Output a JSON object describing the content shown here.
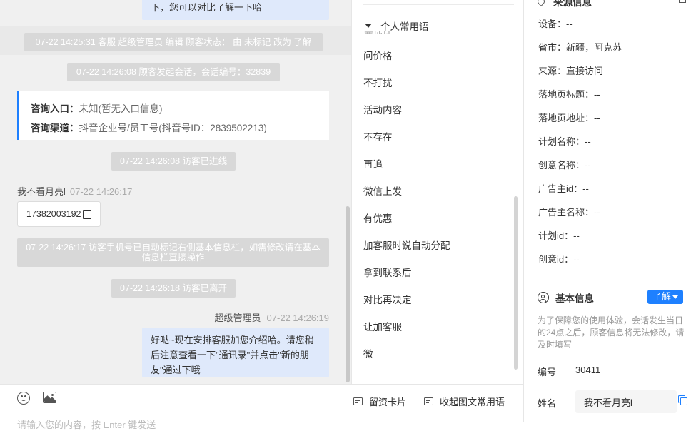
{
  "chat": {
    "top_bubble_text": "下，您可以对比了解一下哈",
    "system_status_change": "07-22 14:25:31 客服 超级管理员 编辑 顾客状态： 由 未标记 改为 了解",
    "system_session_start": "07-22 14:26:08 顾客发起会话，会话编号：32839",
    "consult_entry_label": "咨询入口：",
    "consult_entry_value": "未知(暂无入口信息)",
    "consult_channel_label": "咨询渠道：",
    "consult_channel_value": "抖音企业号/员工号(抖音号ID：2839502213)",
    "system_entered": "07-22 14:26:08 访客已进线",
    "visitor_name": "我不看月亮l",
    "visitor_time": "07-22 14:26:17",
    "visitor_phone": "17382003192",
    "system_phone_tag": "07-22 14:26:17 访客手机号已自动标记右侧基本信息栏，如需修改请在基本信息栏直接操作",
    "system_left": "07-22 14:26:18 访客已离开",
    "agent_name": "超级管理员",
    "agent_time": "07-22 14:26:19",
    "agent_message": "好哒~现在安排客服加您介绍哈。请您稍后注意查看一下\"通讯录\"并点击\"新的朋友\"通过下哦"
  },
  "composer": {
    "card_button": "留资卡片",
    "phrase_button": "收起图文常用语",
    "placeholder": "请输入您的内容，按 Enter 键发送"
  },
  "phrases": {
    "header": "个人常用语",
    "ghost_item": "要地址",
    "items": [
      "问价格",
      "不打扰",
      "活动内容",
      "不存在",
      "再追",
      "微信上发",
      "有优惠",
      "加客服时说自动分配",
      "拿到联系后",
      "对比再决定",
      "让加客服",
      "微"
    ]
  },
  "info": {
    "source_title": "来源信息",
    "source_rows": [
      "设备：--",
      "省市：新疆，阿克苏",
      "来源：直接访问",
      "落地页标题：--",
      "落地页地址：--",
      "计划名称：--",
      "创意名称：--",
      "广告主id：--",
      "广告主名称：--",
      "计划id：--",
      "创意id：--"
    ],
    "basic_title": "基本信息",
    "learn_button": "了解",
    "hint": "为了保障您的使用体验，会话发生当日的24点之后，顾客信息将无法修改，请及时填写",
    "number_label": "编号",
    "number_value": "30411",
    "name_label": "姓名",
    "name_value": "我不看月亮l"
  },
  "colors": {
    "accent": "#1e80ff",
    "agent_bubble": "#dfe9fb",
    "system_pill": "#d8d8d8",
    "chat_bg": "#f0f0f0"
  }
}
